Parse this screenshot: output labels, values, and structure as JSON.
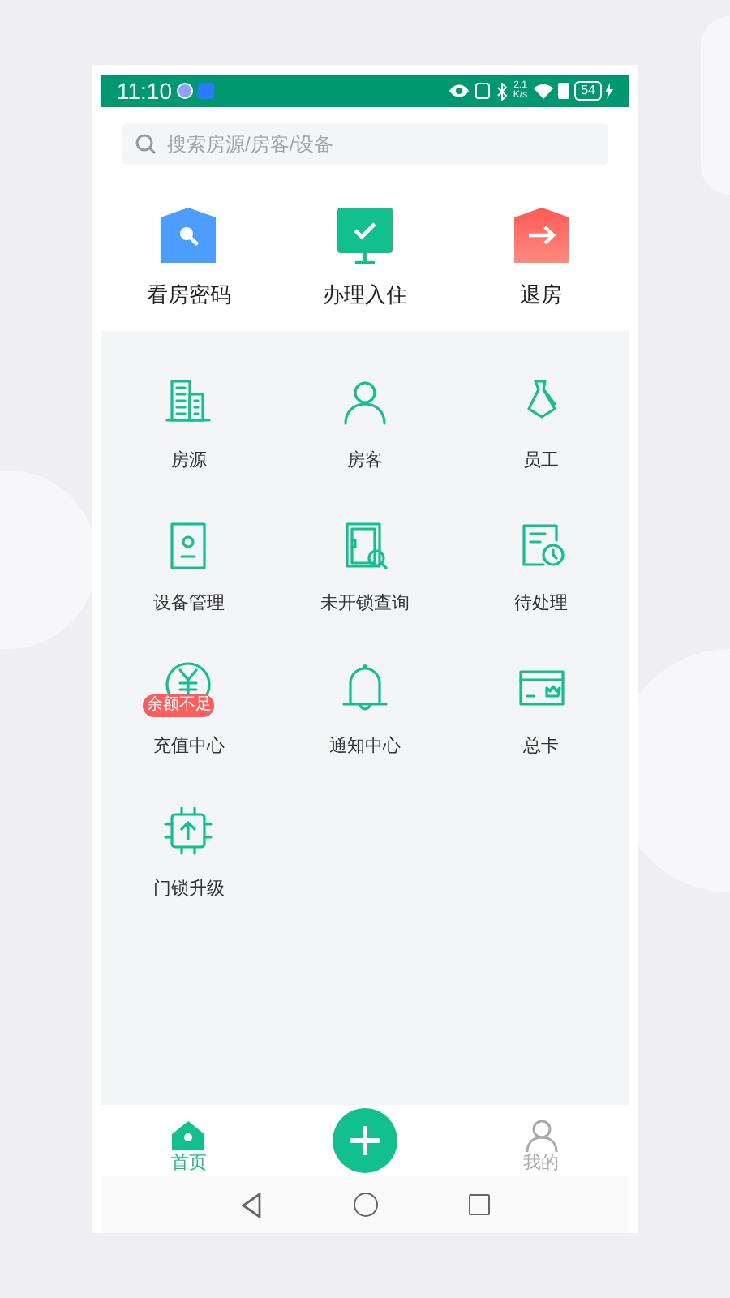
{
  "status_bar": {
    "time": "11:10",
    "speed": "2.1\nK/s",
    "battery": "54"
  },
  "search": {
    "placeholder": "搜索房源/房客/设备"
  },
  "quick_actions": [
    {
      "label": "看房密码",
      "kind": "view"
    },
    {
      "label": "办理入住",
      "kind": "checkin"
    },
    {
      "label": "退房",
      "kind": "checkout"
    }
  ],
  "menu": [
    {
      "label": "房源",
      "kind": "building"
    },
    {
      "label": "房客",
      "kind": "person"
    },
    {
      "label": "员工",
      "kind": "tie"
    },
    {
      "label": "设备管理",
      "kind": "device"
    },
    {
      "label": "未开锁查询",
      "kind": "door"
    },
    {
      "label": "待处理",
      "kind": "pending"
    },
    {
      "label": "充值中心",
      "kind": "yen",
      "badge": "余额不足"
    },
    {
      "label": "通知中心",
      "kind": "bell"
    },
    {
      "label": "总卡",
      "kind": "card"
    },
    {
      "label": "门锁升级",
      "kind": "chip"
    }
  ],
  "bottom_nav": [
    {
      "label": "首页",
      "kind": "home",
      "selected": true
    },
    {
      "kind": "add"
    },
    {
      "label": "我的",
      "kind": "user",
      "selected": false
    }
  ]
}
